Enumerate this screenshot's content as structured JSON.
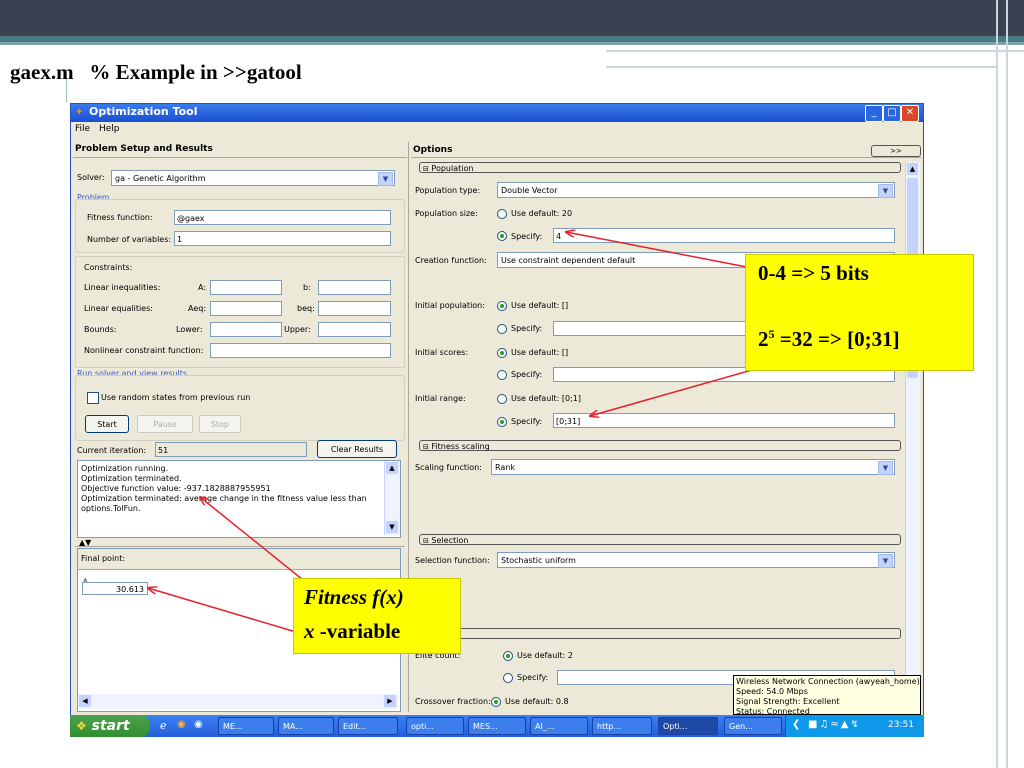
{
  "slide": {
    "title": "gaex.m   % Example in >>gatool"
  },
  "window": {
    "title": "Optimization Tool",
    "menus": [
      "File",
      "Help"
    ]
  },
  "left": {
    "header": "Problem Setup and Results",
    "solver_label": "Solver:",
    "solver_value": "ga - Genetic Algorithm",
    "problem_group": "Problem",
    "fitness_label": "Fitness function:",
    "fitness_value": "@gaex",
    "nvars_label": "Number of variables:",
    "nvars_value": "1",
    "constraints_label": "Constraints:",
    "lin_ineq_label": "Linear inequalities:",
    "a_label": "A:",
    "b_label": "b:",
    "lin_eq_label": "Linear equalities:",
    "aeq_label": "Aeq:",
    "beq_label": "beq:",
    "bounds_label": "Bounds:",
    "lower_label": "Lower:",
    "upper_label": "Upper:",
    "nonlin_label": "Nonlinear constraint function:",
    "run_group": "Run solver and view results",
    "random_states_label": "Use random states from previous run",
    "start_label": "Start",
    "pause_label": "Pause",
    "stop_label": "Stop",
    "iter_label": "Current iteration:",
    "iter_value": "51",
    "clear_label": "Clear Results",
    "output_lines": [
      "Optimization running.",
      "Optimization terminated.",
      "Objective function value: -937.1828887955951",
      "Optimization terminated: average change in the fitness value less than",
      "options.TolFun."
    ],
    "final_point_label": "Final point:",
    "final_point_value": "30.613"
  },
  "right": {
    "header": "Options",
    "collapse_label": ">>",
    "population_section": "Population",
    "pop_type_label": "Population type:",
    "pop_type_value": "Double Vector",
    "pop_size_label": "Population size:",
    "use_default_20": "Use default: 20",
    "specify_label": "Specify:",
    "pop_size_specify_value": "4",
    "creation_label": "Creation function:",
    "creation_value": "Use constraint dependent default",
    "init_pop_label": "Initial population:",
    "use_default_empty": "Use default: []",
    "init_scores_label": "Initial scores:",
    "init_range_label": "Initial range:",
    "use_default_range": "Use default: [0;1]",
    "init_range_value": "[0;31]",
    "fitness_scaling_section": "Fitness scaling",
    "scaling_label": "Scaling function:",
    "scaling_value": "Rank",
    "selection_section": "Selection",
    "selection_label": "Selection function:",
    "selection_value": "Stochastic uniform",
    "elite_label": "Elite count:",
    "use_default_2": "Use default: 2",
    "crossover_label": "Crossover fraction:",
    "use_default_08": "Use default: 0.8"
  },
  "callouts": {
    "bits_line1": "0-4 => 5 bits",
    "bits_line2_base": "2",
    "bits_line2_exp": "5",
    "bits_line2_rest": " =32 => [0;31]",
    "fitness_line1": "Fitness f(x)",
    "fitness_line2_x": "x",
    "fitness_line2_rest": " -variable"
  },
  "tooltip": {
    "lines": [
      "Wireless Network Connection (awyeah_home)",
      "Speed: 54.0 Mbps",
      "Signal Strength: Excellent",
      "Status: Connected"
    ]
  },
  "taskbar": {
    "start_label": "start",
    "tasks": [
      "ME...",
      "MA...",
      "Edit...",
      "opti...",
      "MES...",
      "AI_...",
      "http...",
      "Opti...",
      "Gen..."
    ],
    "clock": "23:51"
  },
  "colors": {
    "callout_bg": "#ffff00",
    "arrow": "#e8202a",
    "titlebar": "#245edb"
  }
}
